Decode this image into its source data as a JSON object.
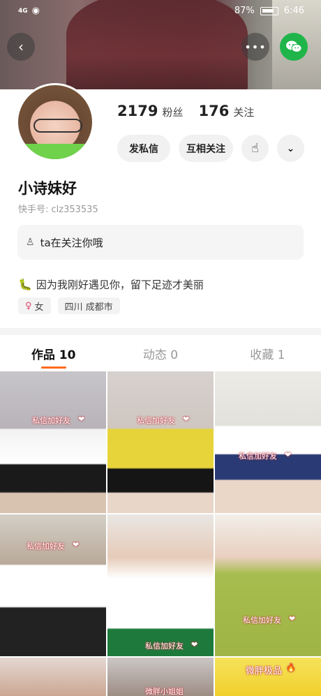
{
  "status_bar": {
    "signal": "4G",
    "battery": "87%",
    "time": "6:46"
  },
  "header": {
    "back_icon": "chevron-left-icon",
    "more_icon": "more-dots-icon",
    "share_icon": "wechat-icon"
  },
  "profile": {
    "fans_count": "2179",
    "fans_label": "粉丝",
    "following_count": "176",
    "following_label": "关注",
    "message_button": "发私信",
    "mutual_follow_button": "互相关注",
    "nickname": "小诗妹好",
    "kuaishou_id": "快手号: clz353535",
    "follow_notice": "ta在关注你哦",
    "bio": "因为我刚好遇见你，留下足迹才美丽",
    "gender_tag": "女",
    "location_tag": "四川 成都市"
  },
  "tabs": [
    {
      "label": "作品 10"
    },
    {
      "label": "动态 0"
    },
    {
      "label": "收藏 1"
    }
  ],
  "grid_captions": [
    "私信加好友",
    "私信加好友",
    "私信加好友",
    "私信加好友",
    "私信加好友",
    "私信加好友",
    "",
    "微胖小姐姐",
    "微胖极品"
  ],
  "colors": {
    "accent": "#ff6a1f",
    "wechat": "#1fb54a"
  }
}
